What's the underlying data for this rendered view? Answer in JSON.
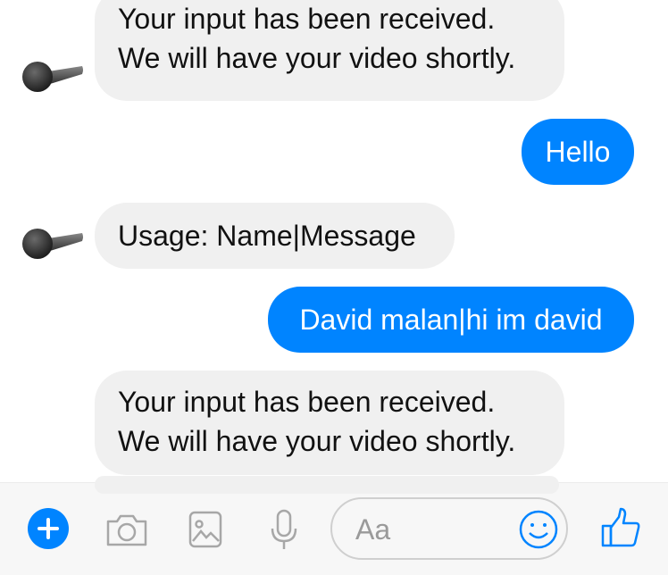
{
  "messages": [
    {
      "sender": "bot",
      "lines": [
        "Your input has been received.",
        "We will have your video shortly."
      ]
    },
    {
      "sender": "user",
      "text": "Hello"
    },
    {
      "sender": "bot",
      "text": "Usage: Name|Message"
    },
    {
      "sender": "user",
      "text": "David malan|hi im david"
    },
    {
      "sender": "bot",
      "lines": [
        "Your input has been received.",
        "We will have your video shortly."
      ]
    }
  ],
  "composer": {
    "placeholder": "Aa",
    "icons": [
      "plus-icon",
      "camera-icon",
      "image-icon",
      "microphone-icon",
      "emoji-icon",
      "thumbs-up-icon"
    ]
  },
  "colors": {
    "accent": "#0084ff",
    "incoming_bubble": "#f0f0f0",
    "outgoing_text": "#ffffff"
  }
}
